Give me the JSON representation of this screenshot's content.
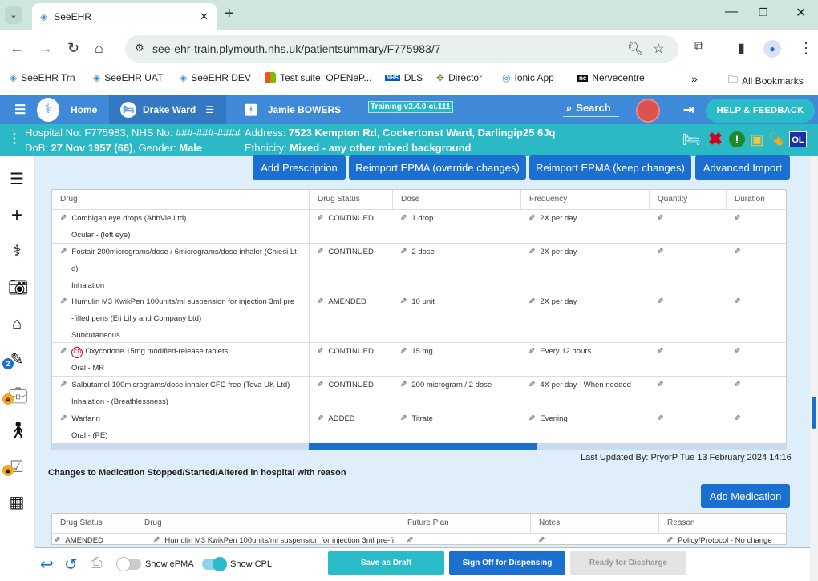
{
  "browser": {
    "tab_title": "SeeEHR",
    "url": "see-ehr-train.plymouth.nhs.uk/patientsummary/F775983/7",
    "bookmarks": [
      "SeeEHR Trn",
      "SeeEHR UAT",
      "SeeEHR DEV",
      "Test suite: OPENeP...",
      "DLS",
      "Director",
      "Ionic App",
      "Nervecentre"
    ],
    "all_bookmarks": "All Bookmarks",
    "chevron": "»"
  },
  "appbar": {
    "home": "Home",
    "ward": "Drake Ward",
    "patient": "Jamie BOWERS",
    "training": "Training v2.4.0-ci.111",
    "search": "Search",
    "help": "HELP & FEEDBACK"
  },
  "patient": {
    "hospital_line": "Hospital No: F775983, NHS No: ###-###-####",
    "dob_label": "DoB: ",
    "dob_value": "27 Nov 1957 (66)",
    "gender_label": ", Gender: ",
    "gender_value": "Male",
    "address_label": "Address: ",
    "address_value": "7523 Kempton Rd, Cockertonst Ward, Darlingip25 6Jq",
    "ethnicity_label": "Ethnicity: ",
    "ethnicity_value": "Mixed - any other mixed background",
    "ol_badge": "OL"
  },
  "rail": {
    "badge_count": "2"
  },
  "actions": {
    "add_prescription": "Add Prescription",
    "reimport_override": "Reimport EPMA (override changes)",
    "reimport_keep": "Reimport EPMA (keep changes)",
    "advanced_import": "Advanced Import"
  },
  "med_table": {
    "headers": [
      "Drug",
      "Drug Status",
      "Dose",
      "Frequency",
      "Quantity",
      "Duration"
    ],
    "rows": [
      {
        "drug_l1": "Combigan eye drops (AbbVie Ltd)",
        "drug_l2": "",
        "route": "Ocular - (left eye)",
        "status": "CONTINUED",
        "dose": "1 drop",
        "freq": "2X per day",
        "cd": false
      },
      {
        "drug_l1": "Fostair 200micrograms/dose / 6micrograms/dose inhaler (Chiesi Lt",
        "drug_l2": "d)",
        "route": "Inhalation",
        "status": "CONTINUED",
        "dose": "2 dose",
        "freq": "2X per day",
        "cd": false
      },
      {
        "drug_l1": "Humulin M3 KwikPen 100units/ml suspension for injection 3ml pre",
        "drug_l2": "-filled pens (Eli Lilly and Company Ltd)",
        "route": "Subcutaneous",
        "status": "AMENDED",
        "dose": "10 unit",
        "freq": "2X per day",
        "cd": false
      },
      {
        "drug_l1": "Oxycodone 15mg modified-release tablets",
        "drug_l2": "",
        "route": "Oral - MR",
        "status": "CONTINUED",
        "dose": "15 mg",
        "freq": "Every 12 hours",
        "cd": true
      },
      {
        "drug_l1": "Salbutamol 100micrograms/dose inhaler CFC free (Teva UK Ltd)",
        "drug_l2": "",
        "route": "Inhalation - (Breathlessness)",
        "status": "CONTINUED",
        "dose": "200 microgram / 2 dose",
        "freq": "4X per day - When needed",
        "cd": false
      },
      {
        "drug_l1": "Warfarin",
        "drug_l2": "",
        "route": "Oral - (PE)",
        "status": "ADDED",
        "dose": "Titrate",
        "freq": "Evening",
        "cd": false
      }
    ],
    "cd_label": "CD"
  },
  "last_updated": "Last Updated By: PryorP Tue 13 February 2024 14:16",
  "changes_heading": "Changes to Medication Stopped/Started/Altered in hospital with reason",
  "add_medication": "Add Medication",
  "changes_table": {
    "headers": [
      "Drug Status",
      "Drug",
      "Future Plan",
      "Notes",
      "Reason"
    ],
    "row": {
      "status": "AMENDED",
      "drug": "Humulin M3 KwikPen 100units/ml suspension for injection 3ml pre-fi",
      "reason": "Policy/Protocol - No change"
    }
  },
  "footer": {
    "show_epma": "Show ePMA",
    "show_cpl": "Show CPL",
    "save_draft": "Save as Draft",
    "sign_off": "Sign Off for Dispensing",
    "ready_discharge": "Ready for Discharge"
  },
  "colors": {
    "appbar": "#3f8ad8",
    "patient_bar": "#2bb9c6",
    "primary_button": "#1b6fd0",
    "footer_save": "#29bcc8",
    "footer_sign": "#1b6fd0"
  }
}
